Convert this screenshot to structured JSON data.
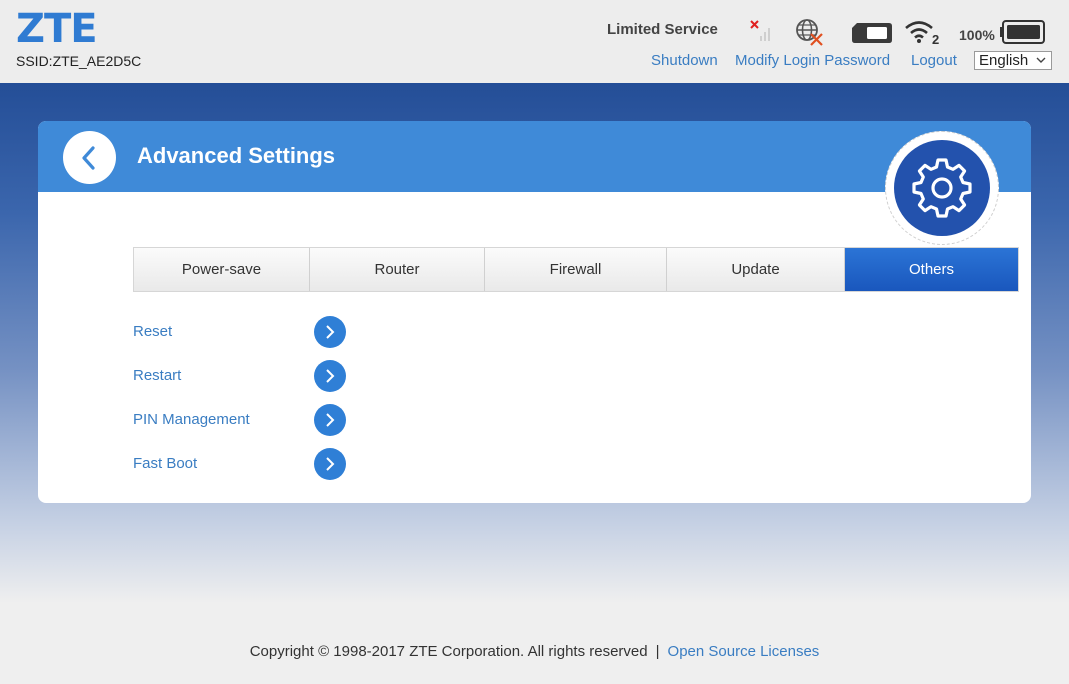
{
  "header": {
    "logo": "ZTE",
    "ssid": "SSID:ZTE_AE2D5C",
    "network_status": "Limited Service",
    "battery_percent": "100%",
    "wifi_clients": "2",
    "links": {
      "shutdown": "Shutdown",
      "modify_password": "Modify Login Password",
      "logout": "Logout"
    },
    "language": "English"
  },
  "icons": {
    "signal": "signal-no-service-icon",
    "internet": "globe-disconnected-icon",
    "sim": "sim-card-icon",
    "wifi": "wifi-icon",
    "battery": "battery-icon",
    "back": "chevron-left-icon",
    "settings": "gear-icon",
    "arrow": "chevron-right-icon"
  },
  "panel": {
    "title": "Advanced Settings",
    "tabs": [
      {
        "label": "Power-save",
        "active": false
      },
      {
        "label": "Router",
        "active": false
      },
      {
        "label": "Firewall",
        "active": false
      },
      {
        "label": "Update",
        "active": false
      },
      {
        "label": "Others",
        "active": true
      }
    ],
    "menu": [
      {
        "label": "Reset"
      },
      {
        "label": "Restart"
      },
      {
        "label": "PIN Management"
      },
      {
        "label": "Fast Boot"
      }
    ]
  },
  "footer": {
    "copyright": "Copyright © 1998-2017 ZTE Corporation. All rights reserved",
    "separator": "|",
    "open_source": "Open Source Licenses"
  },
  "colors": {
    "brand": "#2f7bd2",
    "link": "#3a7dc2",
    "header_bar": "#3f8ad8",
    "active_tab": "#1a57bd"
  }
}
